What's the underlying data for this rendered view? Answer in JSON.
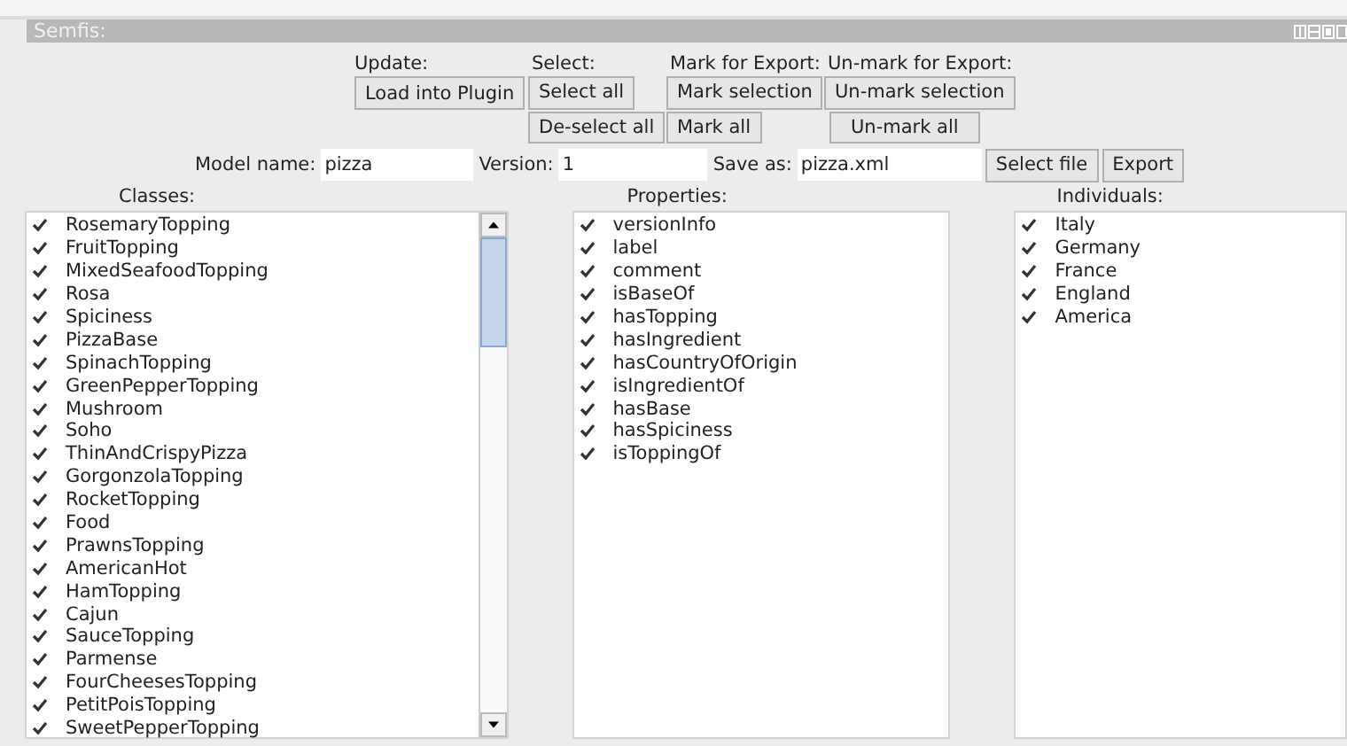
{
  "panel": {
    "title": "Semfis:"
  },
  "button_groups": [
    {
      "label": "Update:",
      "buttons": [
        "Load into Plugin"
      ]
    },
    {
      "label": "Select:",
      "buttons": [
        "Select all",
        "De-select all"
      ]
    },
    {
      "label": "Mark for Export:",
      "buttons": [
        "Mark selection",
        "Mark all"
      ]
    },
    {
      "label": "Un-mark for Export:",
      "buttons": [
        "Un-mark selection",
        "Un-mark all"
      ]
    }
  ],
  "form": {
    "fields": [
      {
        "label": "Model name:",
        "value": "pizza"
      },
      {
        "label": "Version:",
        "value": "1"
      },
      {
        "label": "Save as:",
        "value": "pizza.xml"
      }
    ],
    "buttons": [
      "Select file",
      "Export"
    ]
  },
  "lists": [
    {
      "heading": "Classes:",
      "scrollbar": true,
      "items": [
        {
          "name": "RosemaryTopping",
          "checked": true
        },
        {
          "name": "FruitTopping",
          "checked": true
        },
        {
          "name": "MixedSeafoodTopping",
          "checked": true
        },
        {
          "name": "Rosa",
          "checked": true
        },
        {
          "name": "Spiciness",
          "checked": true
        },
        {
          "name": "PizzaBase",
          "checked": true
        },
        {
          "name": "SpinachTopping",
          "checked": true
        },
        {
          "name": "GreenPepperTopping",
          "checked": true
        },
        {
          "name": "Mushroom",
          "checked": true
        },
        {
          "name": "Soho",
          "checked": true
        },
        {
          "name": "ThinAndCrispyPizza",
          "checked": true
        },
        {
          "name": "GorgonzolaTopping",
          "checked": true
        },
        {
          "name": "RocketTopping",
          "checked": true
        },
        {
          "name": "Food",
          "checked": true
        },
        {
          "name": "PrawnsTopping",
          "checked": true
        },
        {
          "name": "AmericanHot",
          "checked": true
        },
        {
          "name": "HamTopping",
          "checked": true
        },
        {
          "name": "Cajun",
          "checked": true
        },
        {
          "name": "SauceTopping",
          "checked": true
        },
        {
          "name": "Parmense",
          "checked": true
        },
        {
          "name": "FourCheesesTopping",
          "checked": true
        },
        {
          "name": "PetitPoisTopping",
          "checked": true
        },
        {
          "name": "SweetPepperTopping",
          "checked": true
        }
      ]
    },
    {
      "heading": "Properties:",
      "scrollbar": false,
      "items": [
        {
          "name": "versionInfo",
          "checked": true
        },
        {
          "name": "label",
          "checked": true
        },
        {
          "name": "comment",
          "checked": true
        },
        {
          "name": "isBaseOf",
          "checked": true
        },
        {
          "name": "hasTopping",
          "checked": true
        },
        {
          "name": "hasIngredient",
          "checked": true
        },
        {
          "name": "hasCountryOfOrigin",
          "checked": true
        },
        {
          "name": "isIngredientOf",
          "checked": true
        },
        {
          "name": "hasBase",
          "checked": true
        },
        {
          "name": "hasSpiciness",
          "checked": true
        },
        {
          "name": "isToppingOf",
          "checked": true
        }
      ]
    },
    {
      "heading": "Individuals:",
      "scrollbar": false,
      "items": [
        {
          "name": "Italy",
          "checked": true
        },
        {
          "name": "Germany",
          "checked": true
        },
        {
          "name": "France",
          "checked": true
        },
        {
          "name": "England",
          "checked": true
        },
        {
          "name": "America",
          "checked": true
        }
      ]
    }
  ]
}
